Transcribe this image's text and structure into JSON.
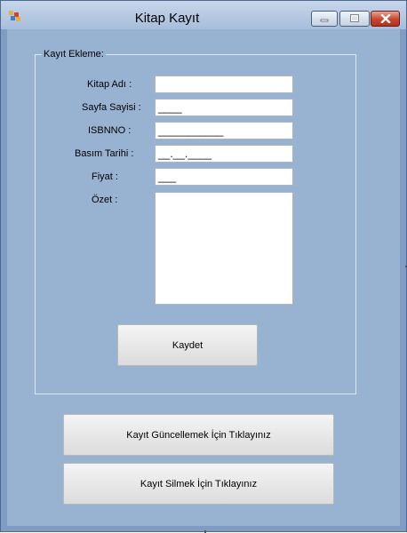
{
  "window": {
    "title": "Kitap Kayıt",
    "controls": {
      "minimize": "minimize-icon",
      "maximize": "maximize-icon",
      "close": "close-icon"
    }
  },
  "group": {
    "legend": "Kayıt Ekleme:",
    "fields": [
      {
        "label": "Kitap Adı :",
        "value": ""
      },
      {
        "label": "Sayfa Sayisi :",
        "value": "____"
      },
      {
        "label": "ISBNNO :",
        "value": "___________"
      },
      {
        "label": "Basım Tarihi :",
        "value": "__.__.____"
      },
      {
        "label": "Fiyat :",
        "value": "___"
      },
      {
        "label": "Özet :",
        "value": ""
      }
    ],
    "save_button": "Kaydet"
  },
  "buttons": {
    "update": "Kayıt Güncellemek İçin Tıklayınız",
    "delete": "Kayıt Silmek İçin Tıklayınız"
  },
  "colors": {
    "client_background": "#98b3d2",
    "window_frame": "#7f9dc4",
    "close_button": "#c9452c"
  }
}
